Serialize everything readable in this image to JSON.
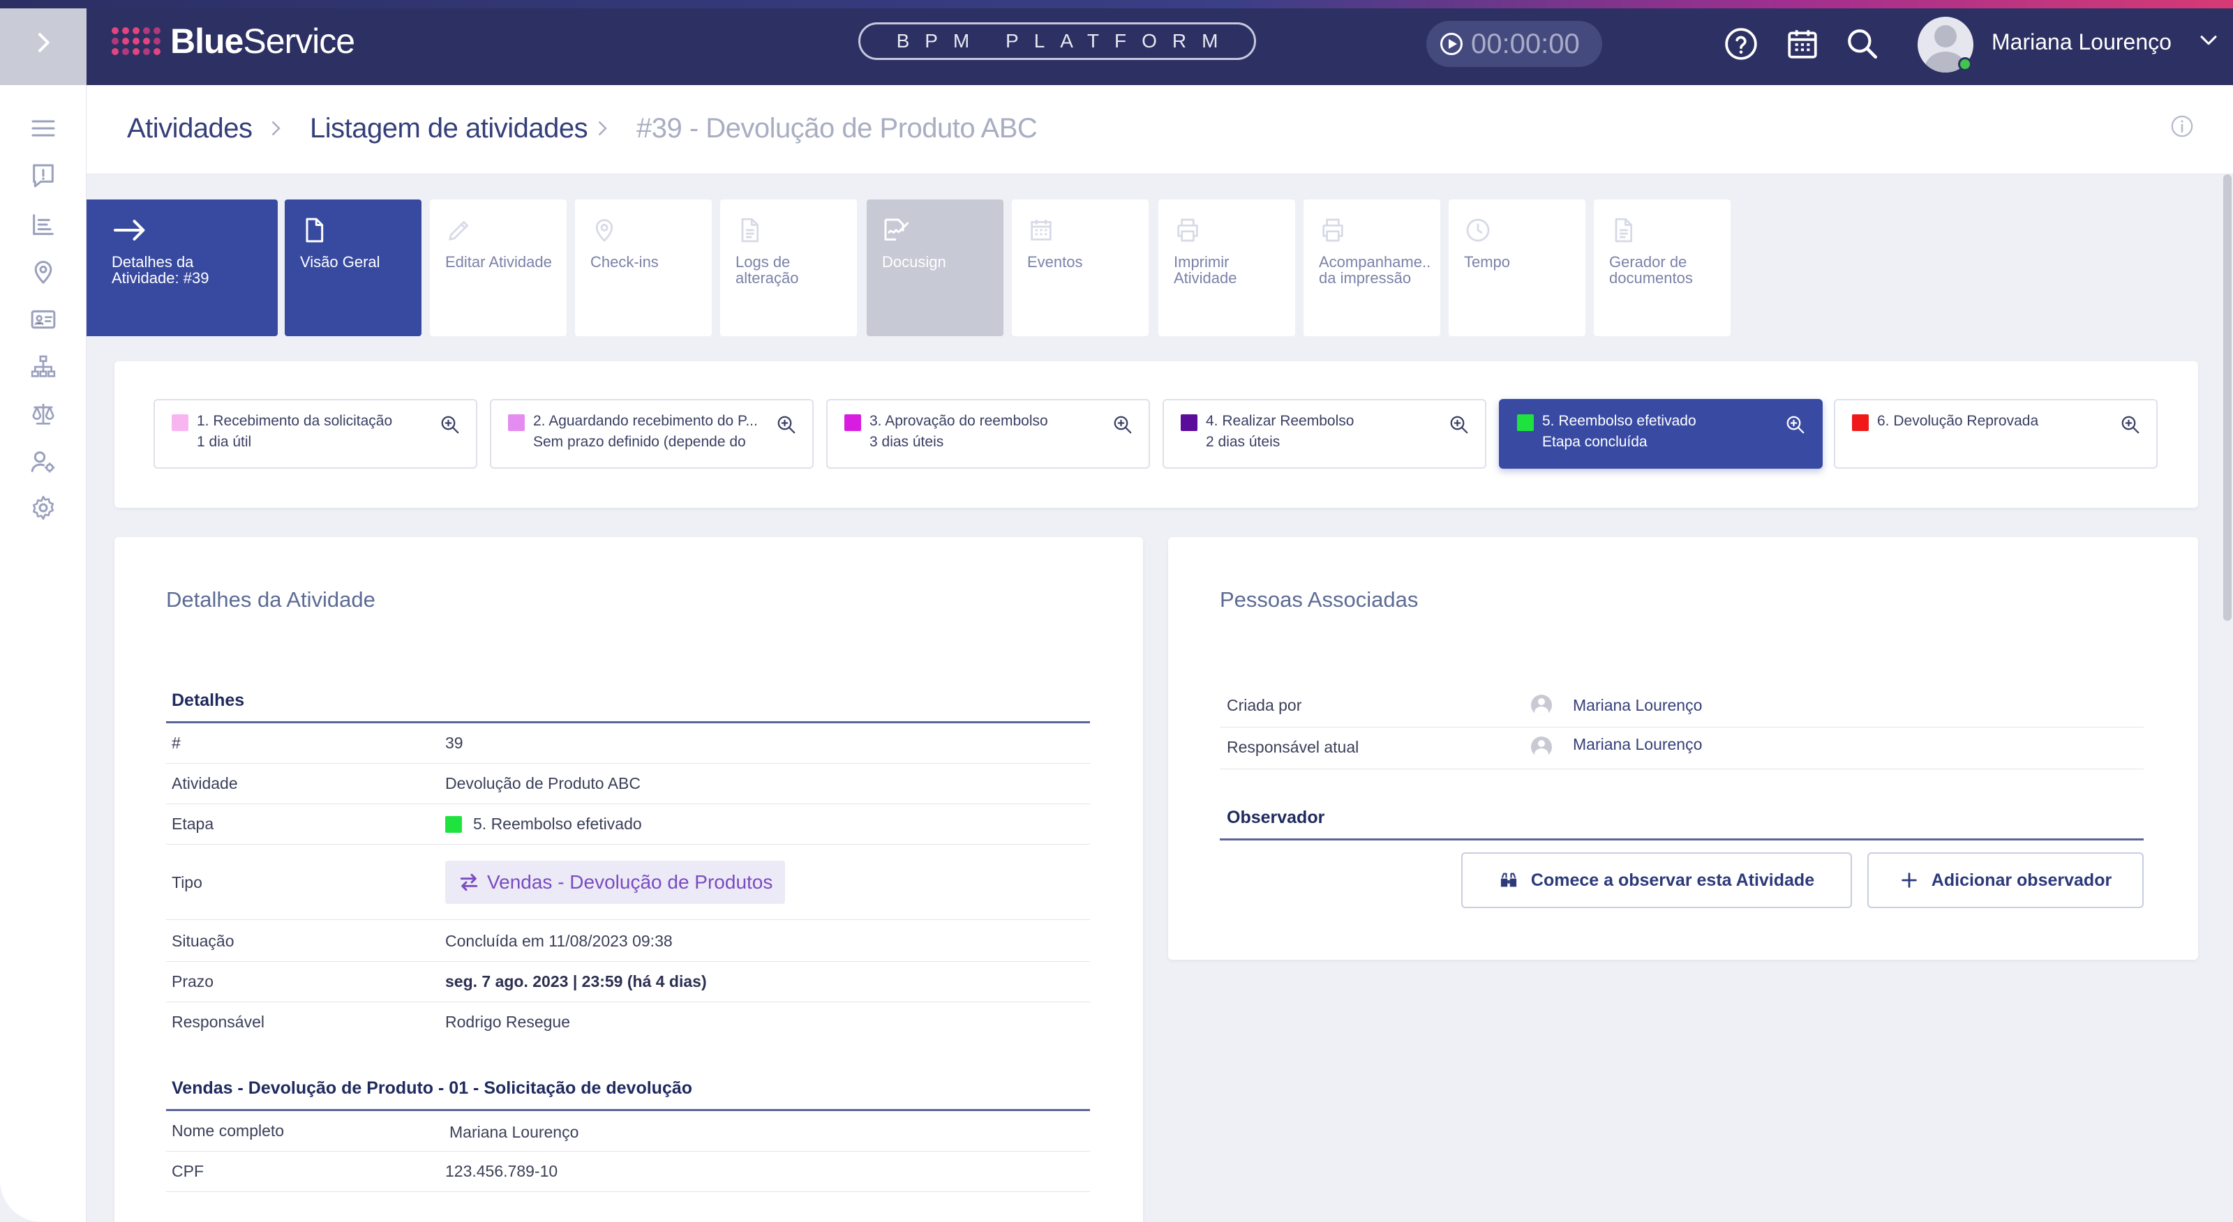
{
  "colors": {
    "header": "#2d3062",
    "accent": "#384aa0",
    "brand_dots": "#e2457f",
    "online": "#3fc64b"
  },
  "header": {
    "logo_bold": "Blue",
    "logo_rest": "Service",
    "platform_label": "BPM PLATFORM",
    "timer": "00:00:00",
    "user_name": "Mariana Lourenço",
    "icons": [
      "help-icon",
      "calendar-icon",
      "search-icon"
    ]
  },
  "sidebar": {
    "icons": [
      "menu-icon",
      "alert-icon",
      "list-icon",
      "location-icon",
      "id-card-icon",
      "org-chart-icon",
      "balance-icon",
      "user-settings-icon",
      "gear-icon"
    ]
  },
  "breadcrumb": {
    "items": [
      "Atividades",
      "Listagem de atividades",
      "#39 - Devolução de Produto ABC"
    ]
  },
  "tabs": [
    {
      "label": "Detalhes da Atividade: #39",
      "icon": "arrow-right-icon"
    },
    {
      "label": "Visão Geral",
      "icon": "document-icon"
    },
    {
      "label": "Editar Atividade",
      "icon": "pencil-icon"
    },
    {
      "label": "Check-ins",
      "icon": "location-icon"
    },
    {
      "label": "Logs de alteração",
      "icon": "file-icon"
    },
    {
      "label": "Docusign",
      "icon": "signature-icon"
    },
    {
      "label": "Eventos",
      "icon": "calendar-icon"
    },
    {
      "label": "Imprimir Atividade",
      "icon": "printer-icon"
    },
    {
      "label": "Acompanhame.. da impressão",
      "icon": "printer-icon"
    },
    {
      "label": "Tempo",
      "icon": "clock-icon"
    },
    {
      "label": "Gerador de documentos",
      "icon": "file-icon"
    }
  ],
  "steps": [
    {
      "title": "1. Recebimento da solicitação",
      "sub": "1 dia útil",
      "color": "#f7b6f0"
    },
    {
      "title": "2. Aguardando recebimento do P...",
      "sub": "Sem prazo definido (depende do",
      "color": "#e58cf0"
    },
    {
      "title": "3. Aprovação do reembolso",
      "sub": "3 dias úteis",
      "color": "#d91de0"
    },
    {
      "title": "4. Realizar Reembolso",
      "sub": "2 dias úteis",
      "color": "#5c0c9a"
    },
    {
      "title": "5. Reembolso efetivado",
      "sub": "Etapa concluída",
      "color": "#1ee33e"
    },
    {
      "title": "6. Devolução Reprovada",
      "sub": "",
      "color": "#f01818"
    }
  ],
  "details": {
    "card_title": "Detalhes da Atividade",
    "section": "Detalhes",
    "rows": [
      {
        "label": "#",
        "value": "39"
      },
      {
        "label": "Atividade",
        "value": "Devolução de Produto ABC"
      },
      {
        "label": "Etapa",
        "value": "5. Reembolso efetivado"
      },
      {
        "label": "Tipo",
        "value": "Vendas - Devolução de Produtos"
      },
      {
        "label": "Situação",
        "value": "Concluída em 11/08/2023 09:38"
      },
      {
        "label": "Prazo",
        "value": "seg. 7 ago. 2023 | 23:59 (há 4 dias)"
      },
      {
        "label": "Responsável",
        "value": "Rodrigo Resegue"
      }
    ],
    "section2": "Vendas - Devolução de Produto - 01 - Solicitação de devolução",
    "rows2": [
      {
        "label": "Nome completo",
        "value": "Mariana Lourenço"
      },
      {
        "label": "CPF",
        "value": "123.456.789-10"
      }
    ]
  },
  "people": {
    "card_title": "Pessoas Associadas",
    "rows": [
      {
        "label": "Criada por",
        "value": "Mariana Lourenço"
      },
      {
        "label": "Responsável atual",
        "value": "Mariana Lourenço"
      }
    ],
    "observer_head": "Observador",
    "btn_watch": "Comece a observar esta Atividade",
    "btn_add": "Adicionar observador"
  }
}
